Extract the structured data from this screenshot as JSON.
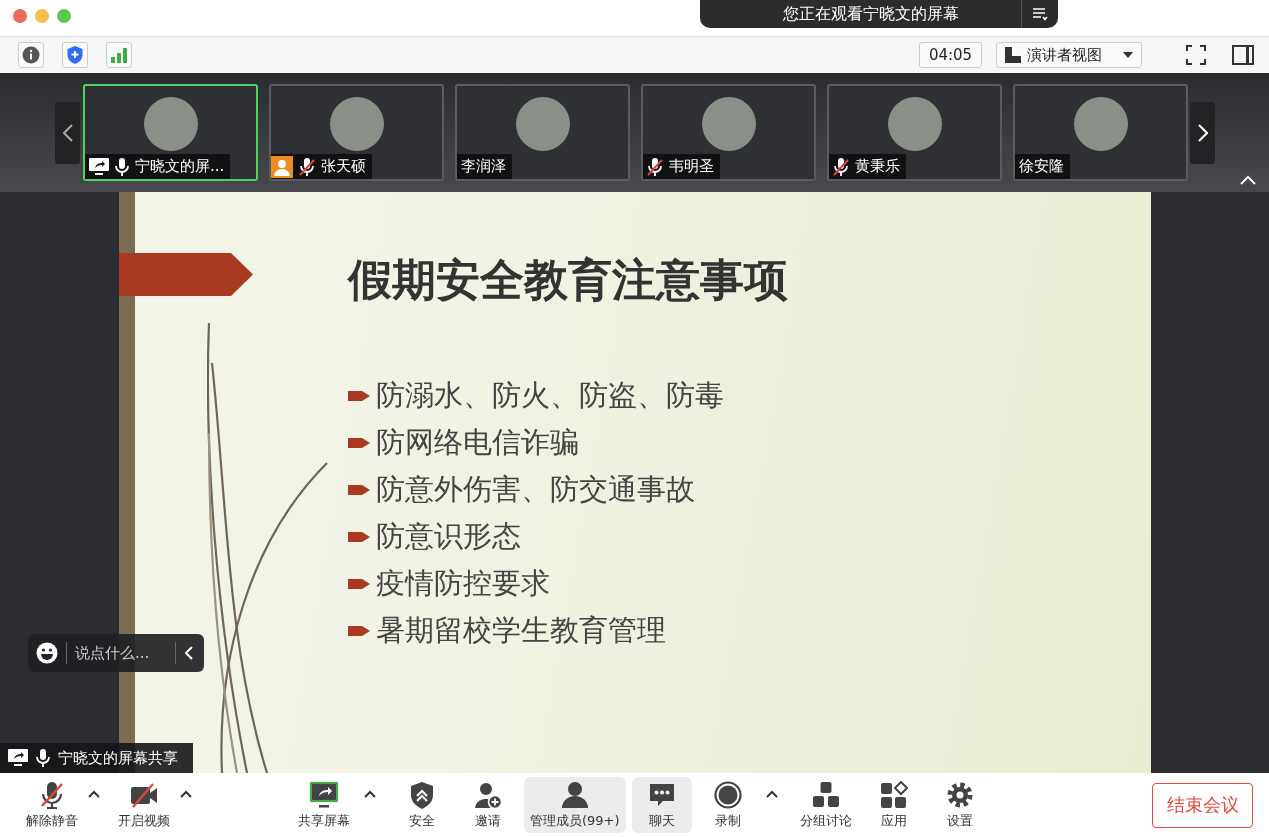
{
  "banner": {
    "text": "您正在观看宁晓文的屏幕"
  },
  "toolbar": {
    "timer": "04:05",
    "view_button": "演讲者视图"
  },
  "participants": [
    {
      "name": "宁晓文的屏...",
      "selected": true,
      "sharing": true,
      "mic": true,
      "muted": false,
      "no_video": false
    },
    {
      "name": "张天硕",
      "selected": false,
      "sharing": false,
      "mic": true,
      "muted": true,
      "no_video": true
    },
    {
      "name": "李润泽",
      "selected": false,
      "sharing": false,
      "mic": false,
      "muted": false,
      "no_video": false
    },
    {
      "name": "韦明圣",
      "selected": false,
      "sharing": false,
      "mic": true,
      "muted": true,
      "no_video": false
    },
    {
      "name": "黄秉乐",
      "selected": false,
      "sharing": false,
      "mic": true,
      "muted": true,
      "no_video": false
    },
    {
      "name": "徐安隆",
      "selected": false,
      "sharing": false,
      "mic": false,
      "muted": false,
      "no_video": false
    }
  ],
  "slide": {
    "title": "假期安全教育注意事项",
    "bullets": [
      "防溺水、防火、防盗、防毒",
      "防网络电信诈骗",
      "防意外伤害、防交通事故",
      "防意识形态",
      "疫情防控要求",
      "暑期留校学生教育管理"
    ]
  },
  "chat": {
    "placeholder": "说点什么..."
  },
  "share_label": "宁晓文的屏幕共享",
  "bottom_toolbar": {
    "left": [
      {
        "kind": "mic",
        "label": "解除静音",
        "caret": true,
        "highlighted": false
      },
      {
        "kind": "camera",
        "label": "开启视频",
        "caret": true,
        "highlighted": false
      }
    ],
    "center": [
      {
        "kind": "share",
        "label": "共享屏幕",
        "caret": true,
        "highlighted": false
      },
      {
        "kind": "security",
        "label": "安全",
        "caret": false,
        "highlighted": false
      },
      {
        "kind": "invite",
        "label": "邀请",
        "caret": false,
        "highlighted": false
      },
      {
        "kind": "members",
        "label": "管理成员(99+)",
        "caret": false,
        "highlighted": true
      },
      {
        "kind": "chat",
        "label": "聊天",
        "caret": false,
        "highlighted": true
      },
      {
        "kind": "record",
        "label": "录制",
        "caret": true,
        "highlighted": false
      },
      {
        "kind": "breakout",
        "label": "分组讨论",
        "caret": false,
        "highlighted": false
      },
      {
        "kind": "apps",
        "label": "应用",
        "caret": false,
        "highlighted": false
      },
      {
        "kind": "settings",
        "label": "设置",
        "caret": false,
        "highlighted": false
      }
    ],
    "end_button": "结束会议"
  }
}
